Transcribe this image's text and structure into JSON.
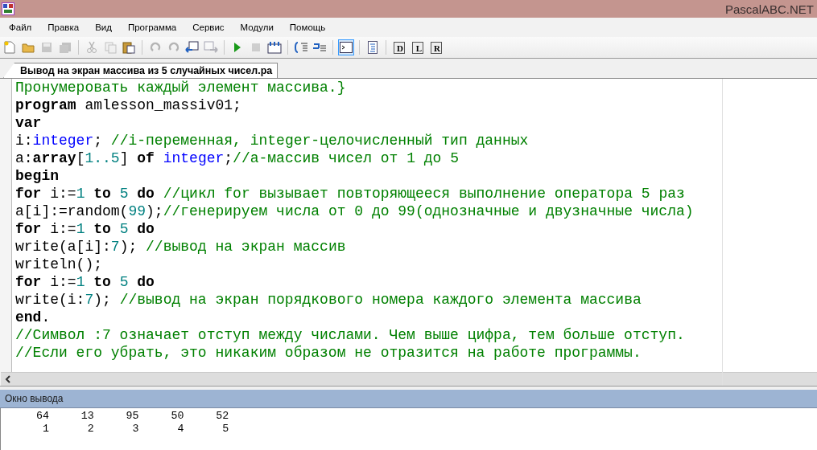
{
  "window": {
    "title": "PascalABC.NET"
  },
  "menu": [
    "Файл",
    "Правка",
    "Вид",
    "Программа",
    "Сервис",
    "Модули",
    "Помощь"
  ],
  "toolbar": [
    {
      "kind": "new",
      "disabled": false,
      "selected": false
    },
    {
      "kind": "open",
      "disabled": false,
      "selected": false
    },
    {
      "kind": "save",
      "disabled": true,
      "selected": false
    },
    {
      "kind": "saveall",
      "disabled": true,
      "selected": false
    },
    {
      "kind": "sep"
    },
    {
      "kind": "cut",
      "disabled": true,
      "selected": false
    },
    {
      "kind": "copy",
      "disabled": true,
      "selected": false
    },
    {
      "kind": "paste",
      "disabled": false,
      "selected": false
    },
    {
      "kind": "sep"
    },
    {
      "kind": "undo",
      "disabled": true,
      "selected": false
    },
    {
      "kind": "redo",
      "disabled": true,
      "selected": false
    },
    {
      "kind": "back",
      "disabled": false,
      "selected": false
    },
    {
      "kind": "forward",
      "disabled": true,
      "selected": false
    },
    {
      "kind": "sep"
    },
    {
      "kind": "run",
      "disabled": false,
      "selected": false
    },
    {
      "kind": "stop",
      "disabled": true,
      "selected": false
    },
    {
      "kind": "build",
      "disabled": false,
      "selected": false
    },
    {
      "kind": "sep"
    },
    {
      "kind": "stepinto",
      "disabled": false,
      "selected": false
    },
    {
      "kind": "stepover",
      "disabled": false,
      "selected": false
    },
    {
      "kind": "sep"
    },
    {
      "kind": "console",
      "disabled": false,
      "selected": true
    },
    {
      "kind": "sep"
    },
    {
      "kind": "format",
      "disabled": false,
      "selected": false
    },
    {
      "kind": "sep"
    },
    {
      "kind": "doc",
      "label": "D",
      "disabled": false,
      "selected": false
    },
    {
      "kind": "doc",
      "label": "L",
      "disabled": false,
      "selected": false
    },
    {
      "kind": "doc",
      "label": "R",
      "disabled": false,
      "selected": false
    }
  ],
  "tabs": [
    {
      "label": "Вывод на экран массива из 5 случайных чисел.pa",
      "selected": true
    }
  ],
  "code": [
    [
      {
        "kind": "comment",
        "text": "Пронумеровать каждый элемент массива.}"
      }
    ],
    [
      {
        "kind": "keyword",
        "text": "program"
      },
      {
        "kind": "plain",
        "text": " amlesson_massiv01;"
      }
    ],
    [
      {
        "kind": "keyword",
        "text": "var"
      }
    ],
    [
      {
        "kind": "plain",
        "text": "i:"
      },
      {
        "kind": "type",
        "text": "integer"
      },
      {
        "kind": "plain",
        "text": "; "
      },
      {
        "kind": "comment",
        "text": "//i-переменная, integer-целочисленный тип данных"
      }
    ],
    [
      {
        "kind": "plain",
        "text": "a:"
      },
      {
        "kind": "keyword",
        "text": "array"
      },
      {
        "kind": "plain",
        "text": "["
      },
      {
        "kind": "number",
        "text": "1..5"
      },
      {
        "kind": "plain",
        "text": "] "
      },
      {
        "kind": "keyword",
        "text": "of "
      },
      {
        "kind": "type",
        "text": "integer"
      },
      {
        "kind": "plain",
        "text": ";"
      },
      {
        "kind": "comment",
        "text": "//а-массив чисел от 1 до 5"
      }
    ],
    [
      {
        "kind": "keyword",
        "text": "begin"
      }
    ],
    [
      {
        "kind": "keyword",
        "text": "for"
      },
      {
        "kind": "plain",
        "text": " i:="
      },
      {
        "kind": "number",
        "text": "1"
      },
      {
        "kind": "keyword",
        "text": " to "
      },
      {
        "kind": "number",
        "text": "5"
      },
      {
        "kind": "keyword",
        "text": " do "
      },
      {
        "kind": "comment",
        "text": "//цикл for вызывает повторяющееся выполнение оператора 5 раз"
      }
    ],
    [
      {
        "kind": "plain",
        "text": "a[i]:=random("
      },
      {
        "kind": "number",
        "text": "99"
      },
      {
        "kind": "plain",
        "text": ");"
      },
      {
        "kind": "comment",
        "text": "//генерируем числа от 0 до 99(однозначные и двузначные числа)"
      }
    ],
    [
      {
        "kind": "keyword",
        "text": "for"
      },
      {
        "kind": "plain",
        "text": " i:="
      },
      {
        "kind": "number",
        "text": "1"
      },
      {
        "kind": "keyword",
        "text": " to "
      },
      {
        "kind": "number",
        "text": "5"
      },
      {
        "kind": "keyword",
        "text": " do"
      }
    ],
    [
      {
        "kind": "plain",
        "text": "write(a[i]:"
      },
      {
        "kind": "number",
        "text": "7"
      },
      {
        "kind": "plain",
        "text": "); "
      },
      {
        "kind": "comment",
        "text": "//вывод на экран массив"
      }
    ],
    [
      {
        "kind": "plain",
        "text": "writeln();"
      }
    ],
    [
      {
        "kind": "keyword",
        "text": "for"
      },
      {
        "kind": "plain",
        "text": " i:="
      },
      {
        "kind": "number",
        "text": "1"
      },
      {
        "kind": "keyword",
        "text": " to "
      },
      {
        "kind": "number",
        "text": "5"
      },
      {
        "kind": "keyword",
        "text": " do"
      }
    ],
    [
      {
        "kind": "plain",
        "text": "write(i:"
      },
      {
        "kind": "number",
        "text": "7"
      },
      {
        "kind": "plain",
        "text": "); "
      },
      {
        "kind": "comment",
        "text": "//вывод на экран порядкового номера каждого элемента массива"
      }
    ],
    [
      {
        "kind": "keyword",
        "text": "end"
      },
      {
        "kind": "plain",
        "text": "."
      }
    ],
    [
      {
        "kind": "comment",
        "text": "//Символ :7 означает отступ между числами. Чем выше цифра, тем больше отступ."
      }
    ],
    [
      {
        "kind": "comment",
        "text": "//Если его убрать, это никаким образом не отразится на работе программы."
      }
    ]
  ],
  "output_panel": {
    "title": "Окно вывода",
    "lines": [
      "     64     13     95     50     52",
      "      1      2      3      4      5"
    ]
  }
}
